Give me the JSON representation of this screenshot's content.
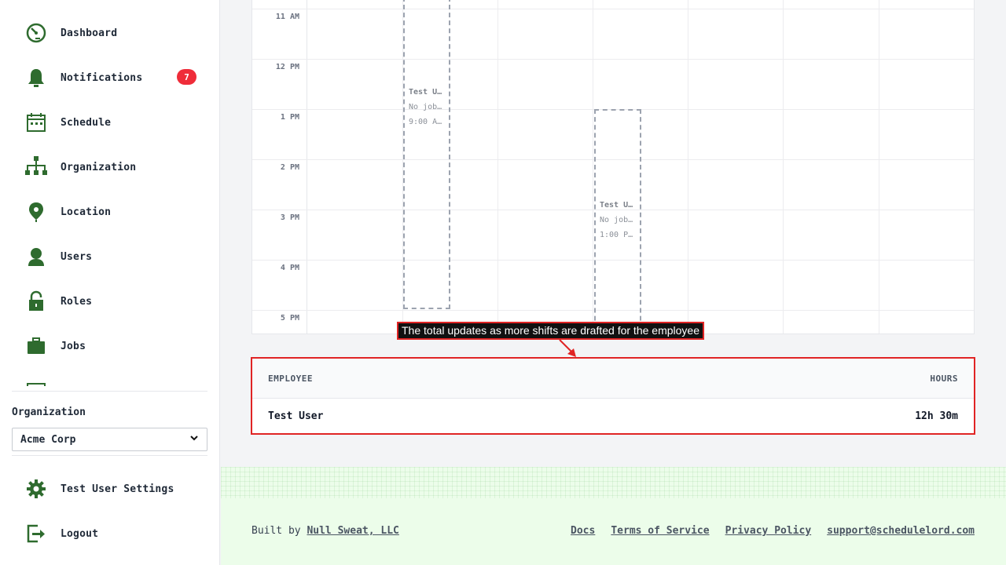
{
  "sidebar": {
    "items": [
      {
        "label": "Dashboard",
        "icon": "dashboard-icon"
      },
      {
        "label": "Notifications",
        "icon": "bell-icon",
        "badge": "7"
      },
      {
        "label": "Schedule",
        "icon": "calendar-icon"
      },
      {
        "label": "Organization",
        "icon": "org-chart-icon"
      },
      {
        "label": "Location",
        "icon": "map-pin-icon"
      },
      {
        "label": "Users",
        "icon": "user-icon"
      },
      {
        "label": "Roles",
        "icon": "lock-icon"
      },
      {
        "label": "Jobs",
        "icon": "briefcase-icon"
      }
    ],
    "organization_label": "Organization",
    "organization_selected": "Acme Corp",
    "settings_label": "Test User Settings",
    "logout_label": "Logout",
    "icon_color": "#2e6b2e",
    "badge_color": "#ef2c39"
  },
  "calendar": {
    "time_labels": [
      "11 AM",
      "12 PM",
      "1 PM",
      "2 PM",
      "3 PM",
      "4 PM",
      "5 PM"
    ],
    "shifts": [
      {
        "title": "Test U…",
        "job": "No job…",
        "time": "9:00 A…"
      },
      {
        "title": "Test U…",
        "job": "No job…",
        "time": "1:00 P…"
      }
    ]
  },
  "annotation": {
    "text": "The total updates as more shifts are drafted for the employee",
    "color": "#e02424"
  },
  "hours_table": {
    "col_employee": "EMPLOYEE",
    "col_hours": "HOURS",
    "rows": [
      {
        "employee": "Test User",
        "hours": "12h 30m"
      }
    ]
  },
  "footer": {
    "built_by": "Built by",
    "company": "Null Sweat, LLC",
    "links": [
      "Docs",
      "Terms of Service",
      "Privacy Policy",
      "support@schedulelord.com"
    ],
    "background": "#ecfdea"
  }
}
